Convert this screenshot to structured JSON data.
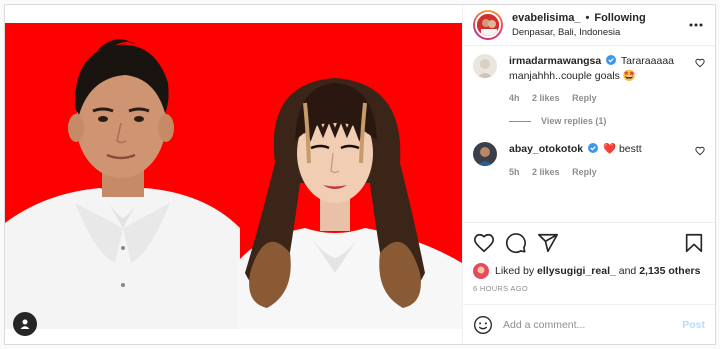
{
  "post": {
    "username": "evabelisima_",
    "follow_status": "Following",
    "location": "Denpasar, Bali, Indonesia",
    "more_icon": "more-horizontal-icon"
  },
  "comments": [
    {
      "username": "irmadarmawangsa",
      "verified": true,
      "text": "Tararaaaaa manjahhh..couple goals 🤩",
      "age": "4h",
      "likes": "2 likes",
      "reply": "Reply",
      "view_replies": "View replies (1)"
    },
    {
      "username": "abay_otokotok",
      "verified": true,
      "text": "❤️ bestt",
      "age": "5h",
      "likes": "2 likes",
      "reply": "Reply"
    }
  ],
  "actions": {
    "like_icon": "heart-icon",
    "comment_icon": "comment-icon",
    "share_icon": "share-icon",
    "save_icon": "bookmark-icon"
  },
  "likes": {
    "prefix": "Liked by",
    "user": "ellysugigi_real_",
    "and": "and",
    "others": "2,135 others"
  },
  "timestamp": "6 HOURS AGO",
  "add_comment": {
    "placeholder": "Add a comment...",
    "post_label": "Post"
  },
  "colors": {
    "photo_background": "#ff0000",
    "verified_blue": "#3897f0",
    "post_button_disabled": "#b2dffc"
  }
}
